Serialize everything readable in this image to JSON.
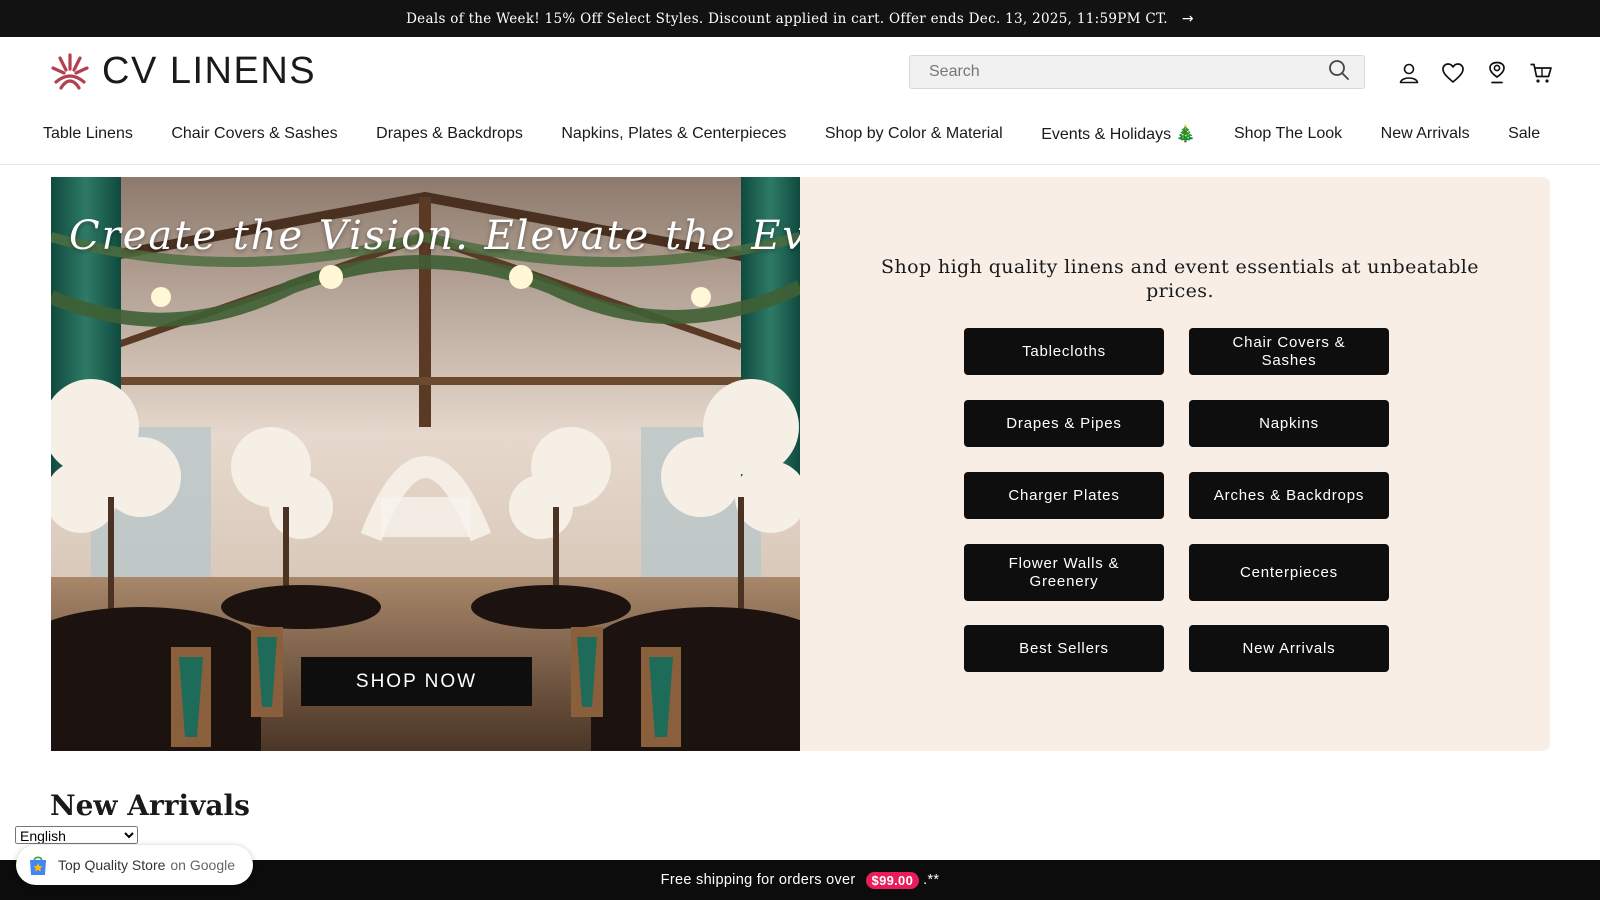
{
  "announcement": {
    "text": "Deals of the Week! 15% Off Select Styles. Discount applied in cart. Offer ends Dec. 13, 2025, 11:59PM CT.",
    "arrow": "→"
  },
  "brand": {
    "name": "CV LINENS",
    "accent": "#b3404f"
  },
  "search": {
    "placeholder": "Search"
  },
  "header_icons": [
    "account-icon",
    "wishlist-heart-icon",
    "store-locator-pin-icon",
    "cart-icon"
  ],
  "nav": {
    "items": [
      "Table Linens",
      "Chair Covers & Sashes",
      "Drapes & Backdrops",
      "Napkins, Plates & Centerpieces",
      "Shop by Color & Material",
      "Events & Holidays 🎄",
      "Shop The Look",
      "New Arrivals",
      "Sale"
    ]
  },
  "hero": {
    "headline": "Create the Vision. Elevate the Event.",
    "cta": "SHOP NOW",
    "tagline": "Shop high quality linens and event essentials at unbeatable prices.",
    "panel_color": "#f8eee6",
    "categories": [
      "Tablecloths",
      "Chair Covers & Sashes",
      "Drapes & Pipes",
      "Napkins",
      "Charger Plates",
      "Arches & Backdrops",
      "Flower Walls & Greenery",
      "Centerpieces",
      "Best Sellers",
      "New Arrivals"
    ]
  },
  "section": {
    "title": "New Arrivals"
  },
  "language": {
    "selected": "English"
  },
  "badge": {
    "label": "Top Quality Store",
    "suffix": "on Google"
  },
  "shipping": {
    "text": "Free shipping for orders over",
    "amount": "$99.00",
    "suffix": ".**"
  }
}
